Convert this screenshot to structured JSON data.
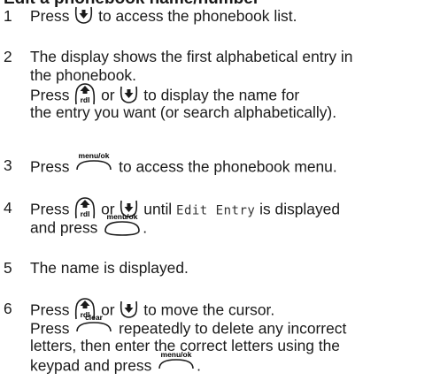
{
  "heading": "Edit a phonebook name/number",
  "steps": [
    {
      "num": "1",
      "a": "Press ",
      "b": " to access the phonebook list."
    },
    {
      "num": "2",
      "l1": "The display shows the first alphabetical entry in",
      "l2": "the phonebook.",
      "l3a": "Press ",
      "l3b": " or ",
      "l3c": " to display the name for",
      "l4": "the entry you want (or search alphabetically)."
    },
    {
      "num": "3",
      "a": "Press ",
      "b": " to access the phonebook menu."
    },
    {
      "num": "4",
      "a": "Press ",
      "b": " or ",
      "c": " until ",
      "d": "Edit Entry",
      "e": " is displayed",
      "l2a": "and press ",
      "l2b": "."
    },
    {
      "num": "5",
      "a": "The name is displayed."
    },
    {
      "num": "6",
      "a": "Press ",
      "b": " or ",
      "c": " to move the cursor.",
      "l2a": "Press ",
      "l2b": " repeatedly to delete any incorrect",
      "l3": "letters, then enter the correct letters using the",
      "l4a": "keypad and press ",
      "l4b": "."
    }
  ],
  "icons": {
    "menu_label": "menu/ok",
    "clear_label": "clear",
    "up_label": "rdl"
  }
}
